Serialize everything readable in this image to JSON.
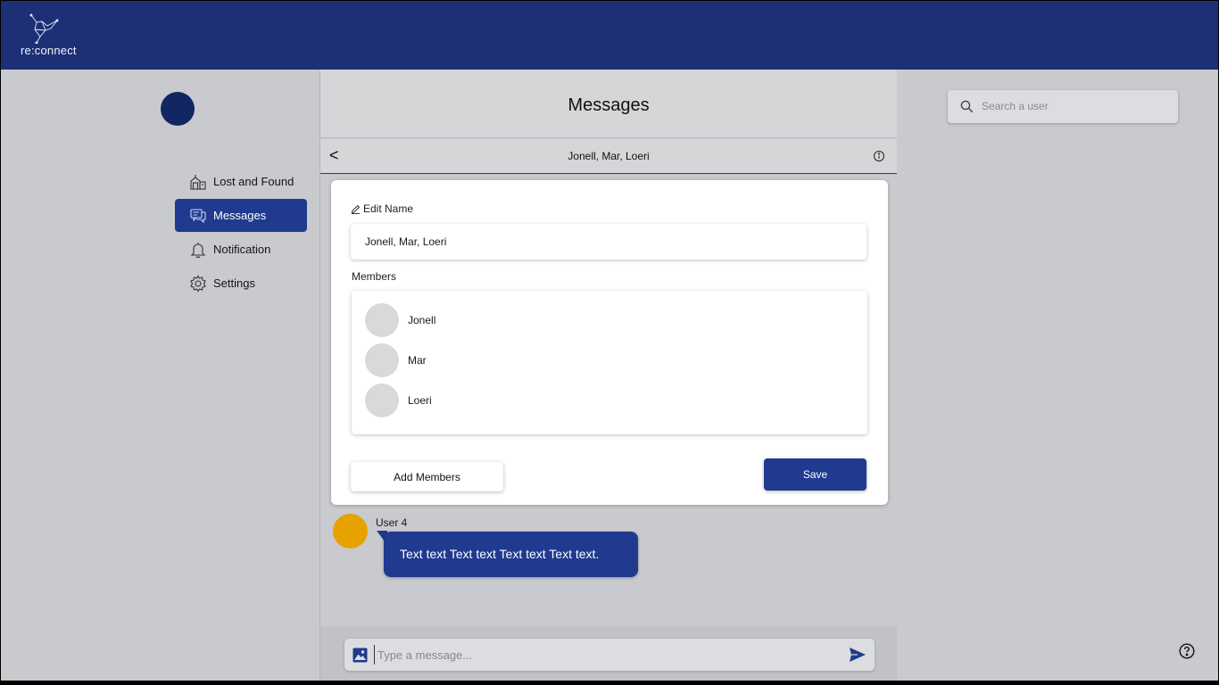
{
  "brand": {
    "logo_text": "re:connect",
    "primary_color": "#1c2f77",
    "accent_color": "#1f3a8f"
  },
  "sidebar": {
    "items": [
      {
        "label": "Lost and Found",
        "icon": "lost-and-found-icon"
      },
      {
        "label": "Messages",
        "icon": "messages-icon",
        "active": true
      },
      {
        "label": "Notification",
        "icon": "bell-icon"
      },
      {
        "label": "Settings",
        "icon": "gear-icon"
      }
    ]
  },
  "main": {
    "title": "Messages",
    "chat": {
      "name": "Jonell, Mar, Loeri",
      "back_label": "<"
    },
    "edit_panel": {
      "edit_name_label": "Edit Name",
      "name_value": "Jonell, Mar, Loeri",
      "members_label": "Members",
      "members": [
        "Jonell",
        "Mar",
        "Loeri"
      ],
      "add_members_label": "Add Members",
      "save_label": "Save"
    },
    "messages": [
      {
        "user": "User 4",
        "text": "Text text Text text Text text Text text."
      }
    ],
    "composer": {
      "placeholder": "Type a message..."
    }
  },
  "search": {
    "placeholder": "Search a user"
  }
}
